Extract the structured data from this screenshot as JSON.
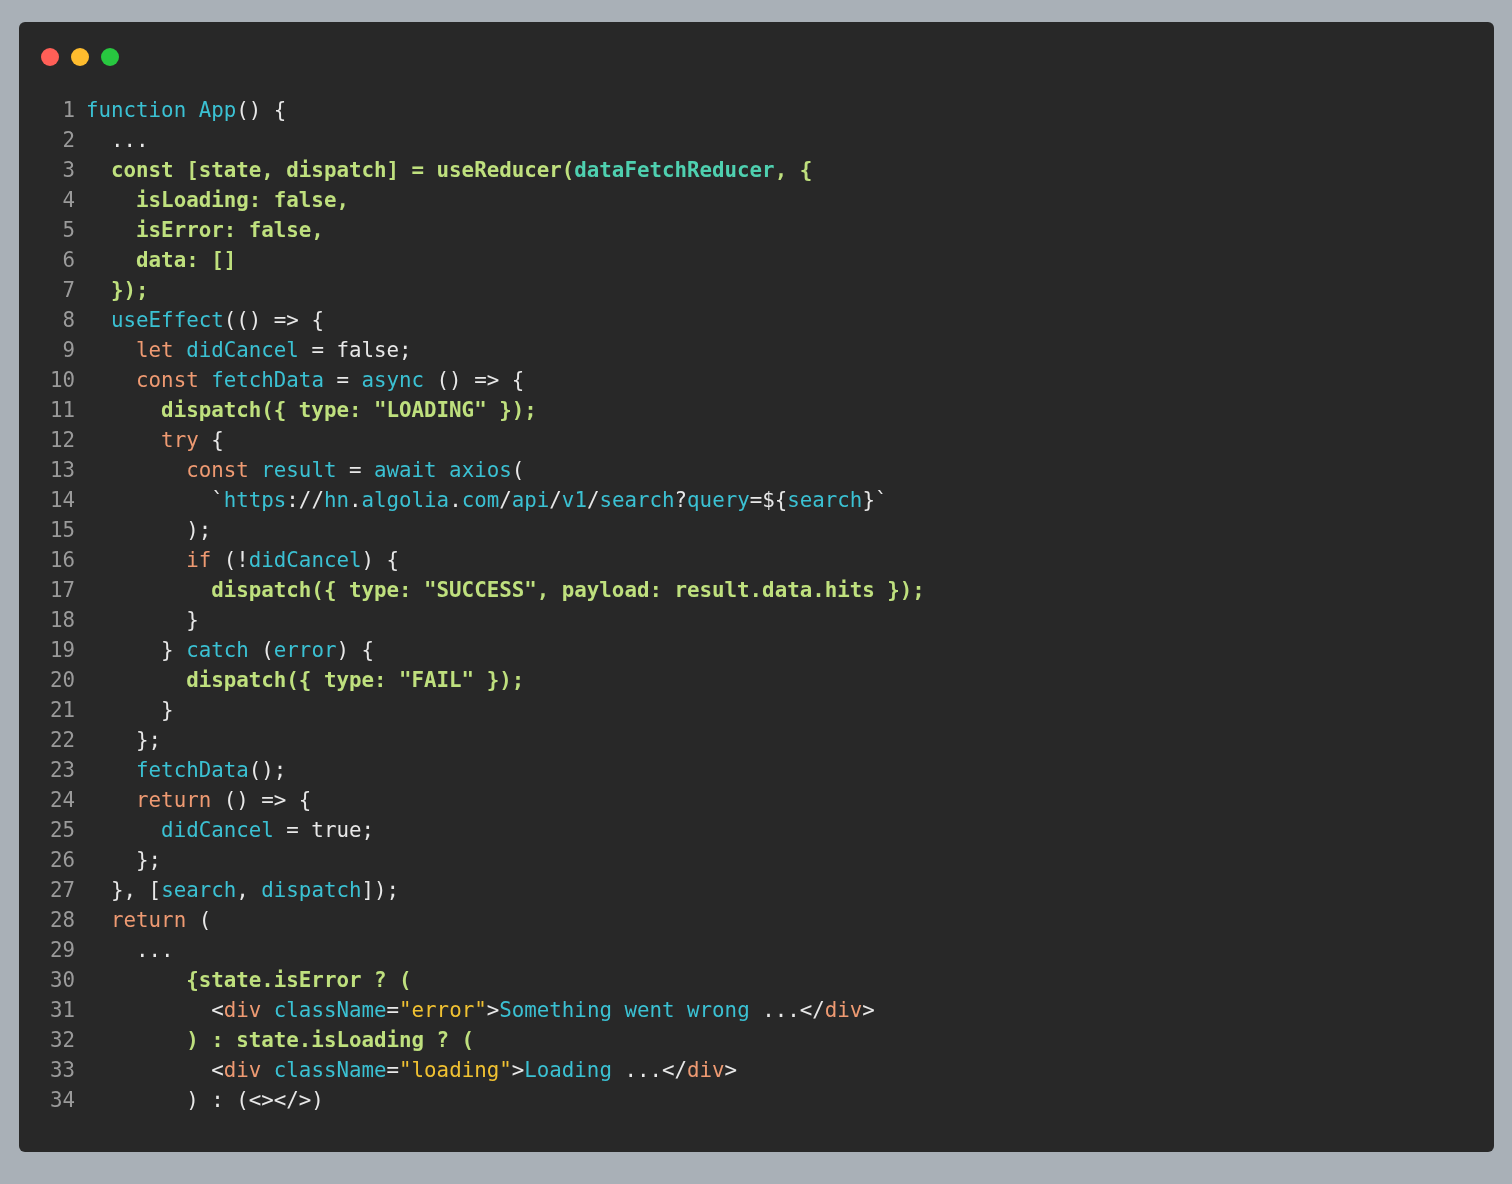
{
  "window": {
    "controls": [
      {
        "kind": "close"
      },
      {
        "kind": "minimize"
      },
      {
        "kind": "zoom"
      }
    ]
  },
  "code": {
    "lines": [
      {
        "number": "1",
        "tokens": [
          {
            "kind": "c",
            "text": "function App"
          },
          {
            "kind": "p",
            "text": "() {"
          }
        ]
      },
      {
        "number": "2",
        "tokens": [
          {
            "kind": "p",
            "text": "  ..."
          }
        ]
      },
      {
        "number": "3",
        "tokens": [
          {
            "kind": "g",
            "text": "  const [state, dispatch] = useReducer("
          },
          {
            "kind": "t",
            "text": "dataFetchReducer"
          },
          {
            "kind": "g",
            "text": ", {"
          }
        ]
      },
      {
        "number": "4",
        "tokens": [
          {
            "kind": "g",
            "text": "    isLoading: false,"
          }
        ]
      },
      {
        "number": "5",
        "tokens": [
          {
            "kind": "g",
            "text": "    isError: false,"
          }
        ]
      },
      {
        "number": "6",
        "tokens": [
          {
            "kind": "g",
            "text": "    data: []"
          }
        ]
      },
      {
        "number": "7",
        "tokens": [
          {
            "kind": "g",
            "text": "  });"
          }
        ]
      },
      {
        "number": "8",
        "tokens": [
          {
            "kind": "c",
            "text": "  useEffect"
          },
          {
            "kind": "p",
            "text": "(() => {"
          }
        ]
      },
      {
        "number": "9",
        "tokens": [
          {
            "kind": "k",
            "text": "    let "
          },
          {
            "kind": "c",
            "text": "didCancel"
          },
          {
            "kind": "p",
            "text": " = false;"
          }
        ]
      },
      {
        "number": "10",
        "tokens": [
          {
            "kind": "k",
            "text": "    const "
          },
          {
            "kind": "c",
            "text": "fetchData"
          },
          {
            "kind": "p",
            "text": " = "
          },
          {
            "kind": "c",
            "text": "async"
          },
          {
            "kind": "p",
            "text": " () => {"
          }
        ]
      },
      {
        "number": "11",
        "tokens": [
          {
            "kind": "g",
            "text": "      dispatch({ type: \"LOADING\" });"
          }
        ]
      },
      {
        "number": "12",
        "tokens": [
          {
            "kind": "k",
            "text": "      try"
          },
          {
            "kind": "p",
            "text": " {"
          }
        ]
      },
      {
        "number": "13",
        "tokens": [
          {
            "kind": "k",
            "text": "        const "
          },
          {
            "kind": "c",
            "text": "result"
          },
          {
            "kind": "p",
            "text": " = "
          },
          {
            "kind": "c",
            "text": "await axios"
          },
          {
            "kind": "p",
            "text": "("
          }
        ]
      },
      {
        "number": "14",
        "tokens": [
          {
            "kind": "p",
            "text": "          `"
          },
          {
            "kind": "c",
            "text": "https"
          },
          {
            "kind": "p",
            "text": "://"
          },
          {
            "kind": "c",
            "text": "hn"
          },
          {
            "kind": "p",
            "text": "."
          },
          {
            "kind": "c",
            "text": "algolia"
          },
          {
            "kind": "p",
            "text": "."
          },
          {
            "kind": "c",
            "text": "com"
          },
          {
            "kind": "p",
            "text": "/"
          },
          {
            "kind": "c",
            "text": "api"
          },
          {
            "kind": "p",
            "text": "/"
          },
          {
            "kind": "c",
            "text": "v1"
          },
          {
            "kind": "p",
            "text": "/"
          },
          {
            "kind": "c",
            "text": "search"
          },
          {
            "kind": "p",
            "text": "?"
          },
          {
            "kind": "c",
            "text": "query"
          },
          {
            "kind": "p",
            "text": "=${"
          },
          {
            "kind": "c",
            "text": "search"
          },
          {
            "kind": "p",
            "text": "}`"
          }
        ]
      },
      {
        "number": "15",
        "tokens": [
          {
            "kind": "p",
            "text": "        );"
          }
        ]
      },
      {
        "number": "16",
        "tokens": [
          {
            "kind": "k",
            "text": "        if"
          },
          {
            "kind": "p",
            "text": " (!"
          },
          {
            "kind": "c",
            "text": "didCancel"
          },
          {
            "kind": "p",
            "text": ") {"
          }
        ]
      },
      {
        "number": "17",
        "tokens": [
          {
            "kind": "g",
            "text": "          dispatch({ type: \"SUCCESS\", payload: result.data.hits });"
          }
        ]
      },
      {
        "number": "18",
        "tokens": [
          {
            "kind": "p",
            "text": "        }"
          }
        ]
      },
      {
        "number": "19",
        "tokens": [
          {
            "kind": "p",
            "text": "      } "
          },
          {
            "kind": "c",
            "text": "catch"
          },
          {
            "kind": "p",
            "text": " ("
          },
          {
            "kind": "c",
            "text": "error"
          },
          {
            "kind": "p",
            "text": ") {"
          }
        ]
      },
      {
        "number": "20",
        "tokens": [
          {
            "kind": "g",
            "text": "        dispatch({ type: \"FAIL\" });"
          }
        ]
      },
      {
        "number": "21",
        "tokens": [
          {
            "kind": "p",
            "text": "      }"
          }
        ]
      },
      {
        "number": "22",
        "tokens": [
          {
            "kind": "p",
            "text": "    };"
          }
        ]
      },
      {
        "number": "23",
        "tokens": [
          {
            "kind": "c",
            "text": "    fetchData"
          },
          {
            "kind": "p",
            "text": "();"
          }
        ]
      },
      {
        "number": "24",
        "tokens": [
          {
            "kind": "k",
            "text": "    return"
          },
          {
            "kind": "p",
            "text": " () => {"
          }
        ]
      },
      {
        "number": "25",
        "tokens": [
          {
            "kind": "c",
            "text": "      didCancel"
          },
          {
            "kind": "p",
            "text": " = true;"
          }
        ]
      },
      {
        "number": "26",
        "tokens": [
          {
            "kind": "p",
            "text": "    };"
          }
        ]
      },
      {
        "number": "27",
        "tokens": [
          {
            "kind": "p",
            "text": "  }, ["
          },
          {
            "kind": "c",
            "text": "search"
          },
          {
            "kind": "p",
            "text": ", "
          },
          {
            "kind": "c",
            "text": "dispatch"
          },
          {
            "kind": "p",
            "text": "]);"
          }
        ]
      },
      {
        "number": "28",
        "tokens": [
          {
            "kind": "k",
            "text": "  return"
          },
          {
            "kind": "p",
            "text": " ("
          }
        ]
      },
      {
        "number": "29",
        "tokens": [
          {
            "kind": "p",
            "text": "    ..."
          }
        ]
      },
      {
        "number": "30",
        "tokens": [
          {
            "kind": "g",
            "text": "        {state.isError ? ("
          }
        ]
      },
      {
        "number": "31",
        "tokens": [
          {
            "kind": "p",
            "text": "          <"
          },
          {
            "kind": "k",
            "text": "div "
          },
          {
            "kind": "c",
            "text": "className"
          },
          {
            "kind": "p",
            "text": "="
          },
          {
            "kind": "s",
            "text": "\"error\""
          },
          {
            "kind": "p",
            "text": ">"
          },
          {
            "kind": "c",
            "text": "Something went wrong"
          },
          {
            "kind": "p",
            "text": " ...</"
          },
          {
            "kind": "k",
            "text": "div"
          },
          {
            "kind": "p",
            "text": ">"
          }
        ]
      },
      {
        "number": "32",
        "tokens": [
          {
            "kind": "g",
            "text": "        ) : state.isLoading ? ("
          }
        ]
      },
      {
        "number": "33",
        "tokens": [
          {
            "kind": "p",
            "text": "          <"
          },
          {
            "kind": "k",
            "text": "div "
          },
          {
            "kind": "c",
            "text": "className"
          },
          {
            "kind": "p",
            "text": "="
          },
          {
            "kind": "s",
            "text": "\"loading\""
          },
          {
            "kind": "p",
            "text": ">"
          },
          {
            "kind": "c",
            "text": "Loading"
          },
          {
            "kind": "p",
            "text": " ...</"
          },
          {
            "kind": "k",
            "text": "div"
          },
          {
            "kind": "p",
            "text": ">"
          }
        ]
      },
      {
        "number": "34",
        "tokens": [
          {
            "kind": "p",
            "text": "        ) : (<></>)"
          }
        ]
      }
    ]
  }
}
